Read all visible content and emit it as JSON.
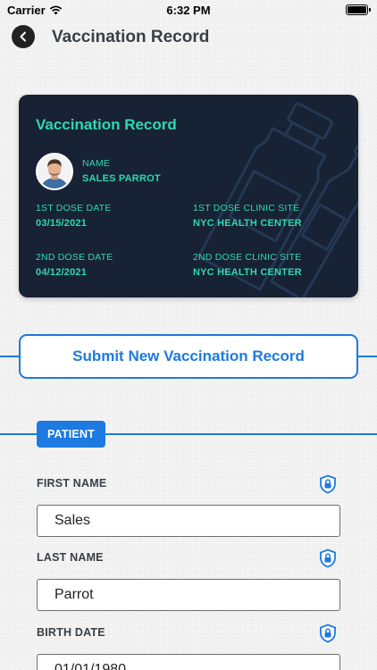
{
  "status_bar": {
    "carrier": "Carrier",
    "time": "6:32 PM"
  },
  "header": {
    "title": "Vaccination Record"
  },
  "card": {
    "title": "Vaccination Record",
    "name_label": "NAME",
    "name_value": "SALES PARROT",
    "dose1_date_label": "1ST DOSE DATE",
    "dose1_date_value": "03/15/2021",
    "dose1_site_label": "1ST DOSE CLINIC SITE",
    "dose1_site_value": "NYC HEALTH CENTER",
    "dose2_date_label": "2ND DOSE DATE",
    "dose2_date_value": "04/12/2021",
    "dose2_site_label": "2ND DOSE CLINIC SITE",
    "dose2_site_value": "NYC HEALTH CENTER"
  },
  "submit_button": {
    "label": "Submit New Vaccination Record"
  },
  "patient": {
    "section_label": "PATIENT",
    "first_name_label": "FIRST NAME",
    "first_name_value": "Sales",
    "last_name_label": "LAST NAME",
    "last_name_value": "Parrot",
    "birth_date_label": "BIRTH DATE",
    "birth_date_value": "01/01/1980"
  },
  "colors": {
    "accent_blue": "#1d7ae0",
    "card_background": "#182235",
    "card_text": "#2fd8ad"
  }
}
